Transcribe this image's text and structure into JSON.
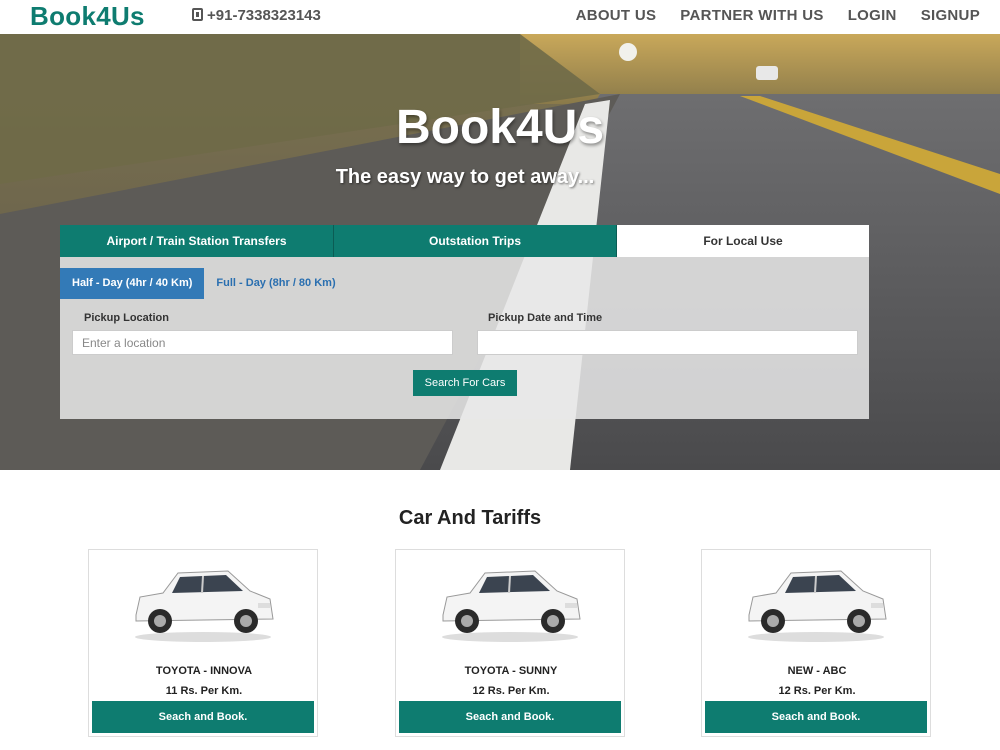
{
  "nav": {
    "brand": "Book4Us",
    "phone": "+91-7338323143",
    "menu": [
      {
        "label": "ABOUT US"
      },
      {
        "label": "PARTNER WITH US"
      },
      {
        "label": "LOGIN"
      },
      {
        "label": "SIGNUP"
      }
    ]
  },
  "hero": {
    "title": "Book4Us",
    "subtitle": "The easy way to get away..."
  },
  "booking": {
    "tabs": [
      {
        "label": "Airport / Train Station Transfers",
        "active": false
      },
      {
        "label": "Outstation Trips",
        "active": false
      },
      {
        "label": "For Local Use",
        "active": true
      }
    ],
    "subtabs": [
      {
        "label": "Half - Day (4hr / 40 Km)",
        "active": true
      },
      {
        "label": "Full - Day (8hr / 80 Km)",
        "active": false
      }
    ],
    "pickup_location_label": "Pickup Location",
    "pickup_location_placeholder": "Enter a location",
    "pickup_location_value": "",
    "pickup_datetime_label": "Pickup Date and Time",
    "pickup_datetime_value": "",
    "search_button": "Search For Cars"
  },
  "cars": {
    "title": "Car And Tariffs",
    "items": [
      {
        "name": "TOYOTA - INNOVA",
        "rate": "11 Rs. Per Km.",
        "button": "Seach and Book."
      },
      {
        "name": "TOYOTA - SUNNY",
        "rate": "12 Rs. Per Km.",
        "button": "Seach and Book."
      },
      {
        "name": "NEW - ABC",
        "rate": "12 Rs. Per Km.",
        "button": "Seach and Book."
      }
    ]
  },
  "colors": {
    "brand": "#0e7c70",
    "active_subtab": "#337ab7"
  },
  "icons": [
    "phone-icon",
    "car-image"
  ]
}
